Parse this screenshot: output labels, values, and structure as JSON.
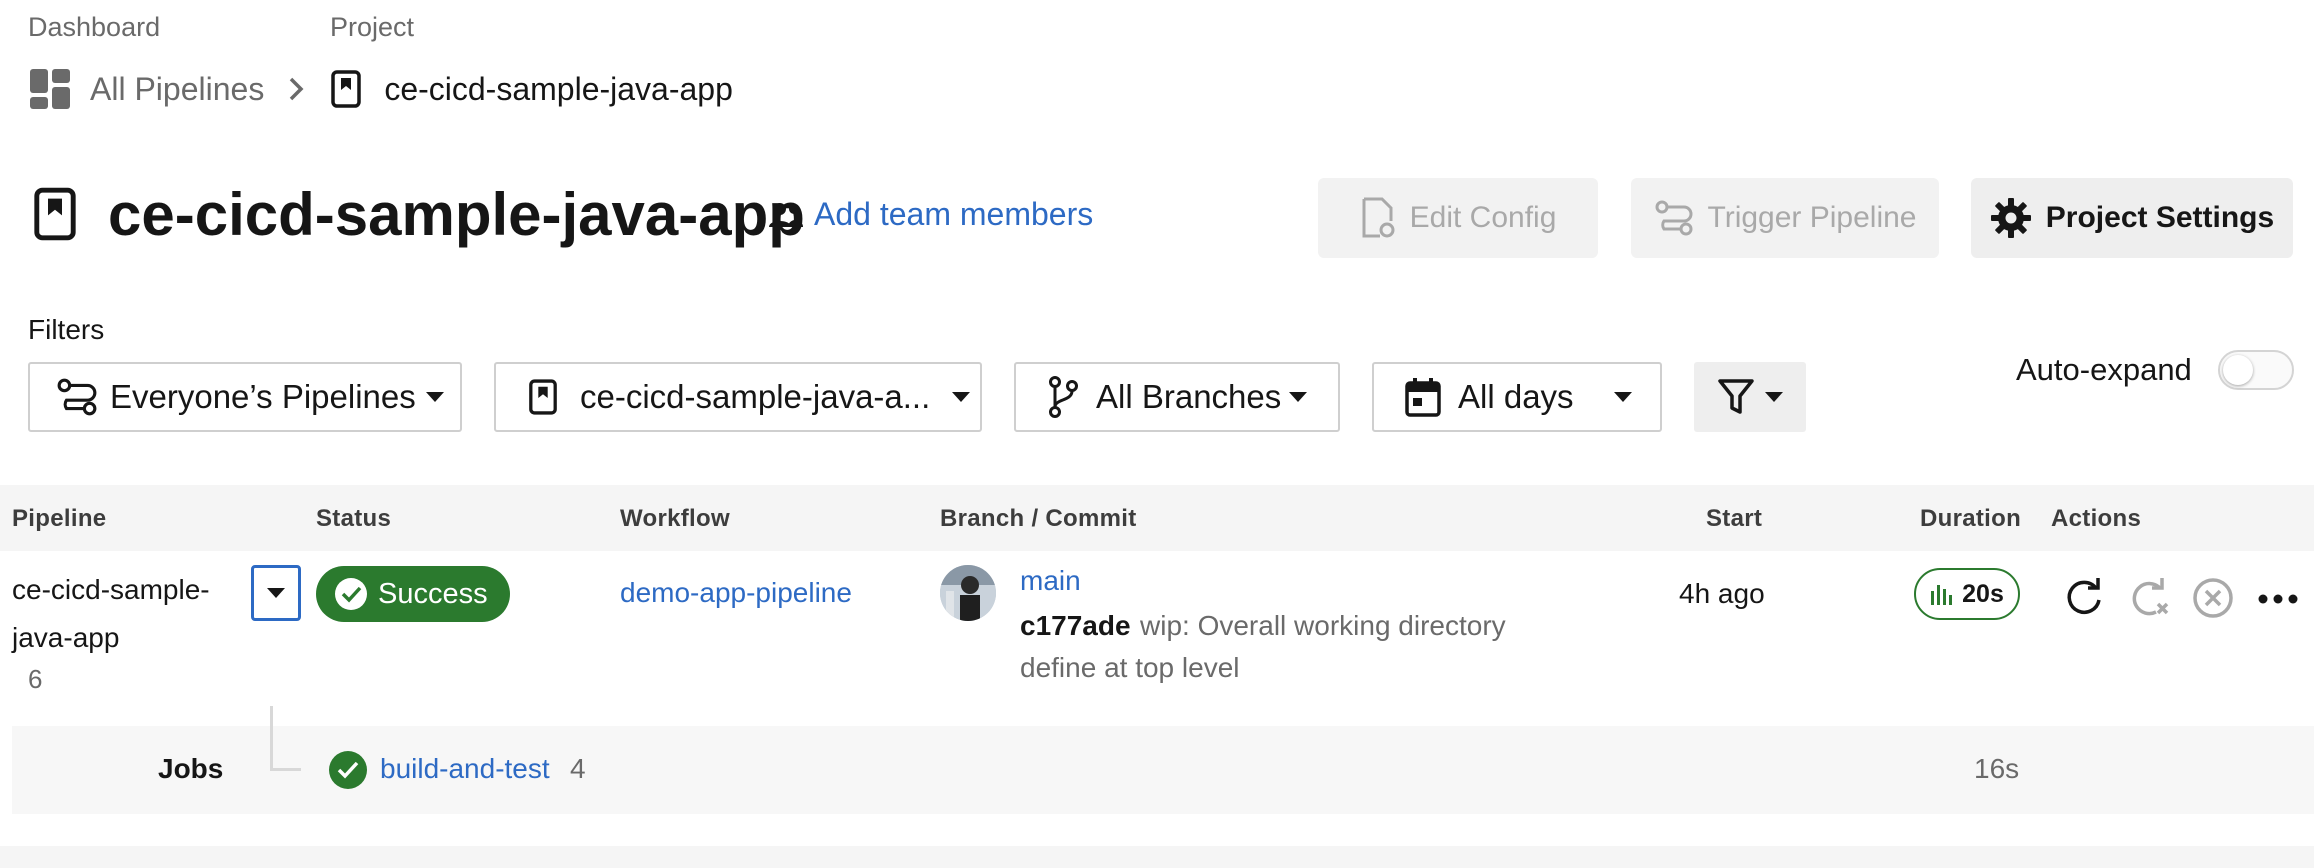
{
  "breadcrumb": {
    "dashboard_label": "Dashboard",
    "project_label": "Project",
    "all_pipelines": "All Pipelines",
    "project_name": "ce-cicd-sample-java-app"
  },
  "header": {
    "title": "ce-cicd-sample-java-app",
    "add_team_members": "Add team members",
    "edit_config": "Edit Config",
    "trigger_pipeline": "Trigger Pipeline",
    "project_settings": "Project Settings"
  },
  "filters": {
    "label": "Filters",
    "pipelines": "Everyone’s Pipelines",
    "project": "ce-cicd-sample-java-a...",
    "branches": "All Branches",
    "days": "All days",
    "auto_expand_label": "Auto-expand",
    "auto_expand_on": false
  },
  "table": {
    "headers": {
      "pipeline": "Pipeline",
      "status": "Status",
      "workflow": "Workflow",
      "branch_commit": "Branch / Commit",
      "start": "Start",
      "duration": "Duration",
      "actions": "Actions"
    },
    "rows": [
      {
        "pipeline_line1": "ce-cicd-sample-",
        "pipeline_line2": "java-app",
        "pipeline_number": "6",
        "status": "Success",
        "workflow": "demo-app-pipeline",
        "branch": "main",
        "commit_hash": "c177ade",
        "commit_msg_line1": "wip: Overall working directory",
        "commit_msg_line2": "define at top level",
        "start": "4h ago",
        "duration": "20s"
      }
    ],
    "jobs": {
      "label": "Jobs",
      "job_name": "build-and-test",
      "job_number": "4",
      "job_duration": "16s"
    }
  },
  "colors": {
    "success": "#2b7a2e",
    "link": "#2d6ac4",
    "focus": "#2d6ac4"
  },
  "icons": [
    "dashboard-icon",
    "chevron-right-icon",
    "project-icon",
    "team-icon",
    "edit-config-icon",
    "trigger-pipeline-icon",
    "gear-icon",
    "pipelines-filter-icon",
    "branch-icon",
    "calendar-icon",
    "funnel-icon",
    "check-icon",
    "chart-icon",
    "rerun-icon",
    "rerun-failed-icon",
    "cancel-icon",
    "more-icon"
  ]
}
